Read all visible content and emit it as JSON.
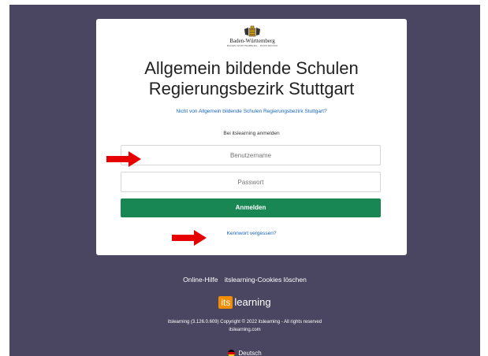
{
  "logo": {
    "text": "Baden-Württemberg",
    "subtext": "BADEN-WÜRTTEMBERG · MINISTERIUM"
  },
  "title": {
    "line1": "Allgemein bildende Schulen",
    "line2": "Regierungsbezirk Stuttgart"
  },
  "not_from_link": "Nicht von Allgemein bildende Schulen Regierungsbezirk Stuttgart?",
  "signin_label": "Bei itslearning anmelden",
  "username": {
    "placeholder": "Benutzername",
    "value": ""
  },
  "password": {
    "placeholder": "Passwort",
    "value": ""
  },
  "login_button": "Anmelden",
  "forgot_link": "Kennwort vergessen?",
  "footer": {
    "help": "Online-Hilfe",
    "cookies": "itslearning-Cookies löschen",
    "brand_its": "its",
    "brand_learning": "learning",
    "copyright": "itslearning (3.126.0.609) Copyright © 2022 itslearning - All rights reserved",
    "site": "itslearning.com",
    "language": "Deutsch"
  },
  "colors": {
    "background": "#4a4560",
    "button": "#198754",
    "link": "#1565c0",
    "arrow": "#e60000",
    "brand": "#f28c00"
  }
}
